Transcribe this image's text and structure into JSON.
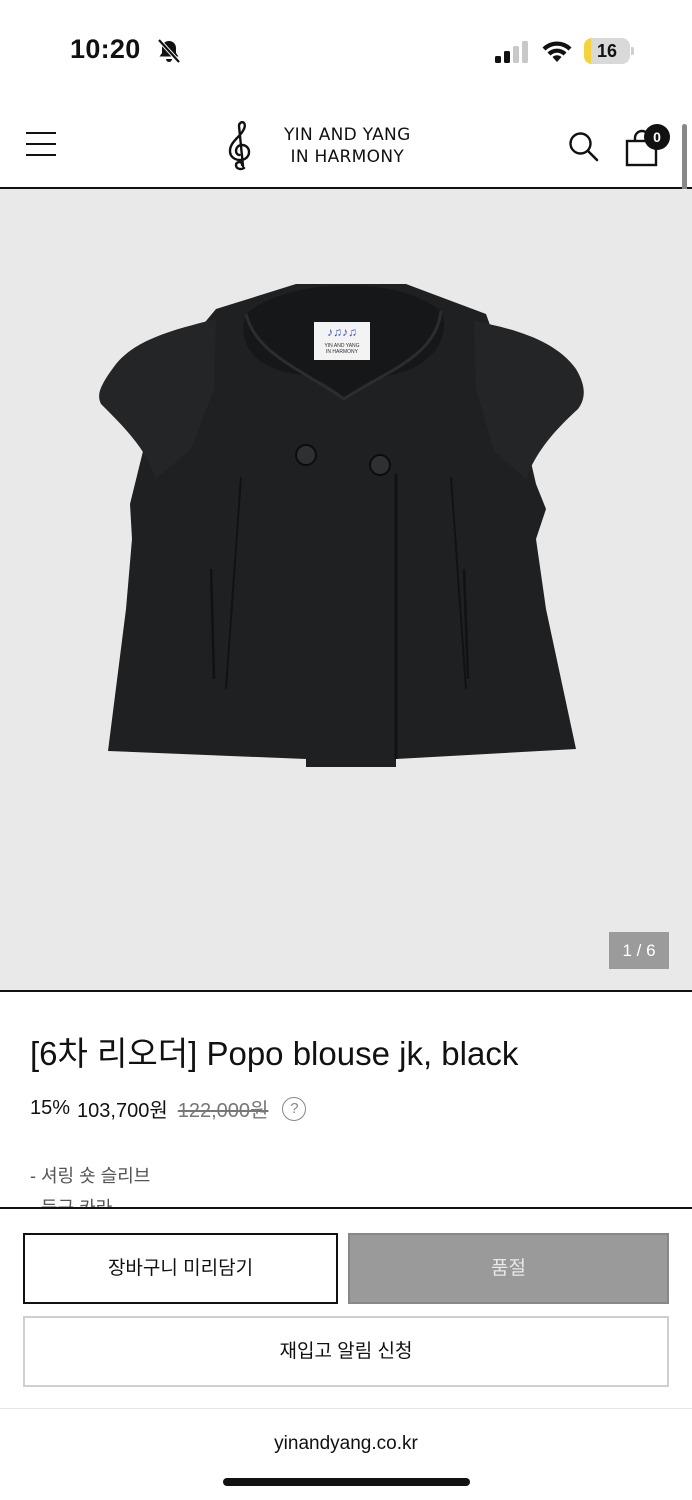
{
  "status_bar": {
    "time": "10:20",
    "battery_level": "16",
    "battery_fraction": 0.16,
    "battery_color": "#f5d33b"
  },
  "header": {
    "logo_line1": "YIN AND YANG",
    "logo_line2": "IN HARMONY",
    "cart_count": "0",
    "icons": [
      "menu-icon",
      "treble-clef-icon",
      "search-icon",
      "shopping-bag-icon"
    ]
  },
  "gallery": {
    "page_indicator": "1 / 6",
    "label_line1": "YIN AND YANG",
    "label_line2": "IN HARMONY",
    "background_color": "#e9e9ea"
  },
  "product": {
    "title": "[6차 리오더] Popo blouse jk, black",
    "discount": "15%",
    "sale_price": "103,700원",
    "original_price": "122,000원",
    "help_symbol": "?",
    "description": [
      "- 셔링 숏 슬리브",
      "- 둥근 카라"
    ]
  },
  "actions": {
    "add_to_cart_label": "장바구니 미리담기",
    "sold_out_label": "품절",
    "restock_label": "재입고 알림 신청"
  },
  "browser": {
    "url": "yinandyang.co.kr"
  }
}
